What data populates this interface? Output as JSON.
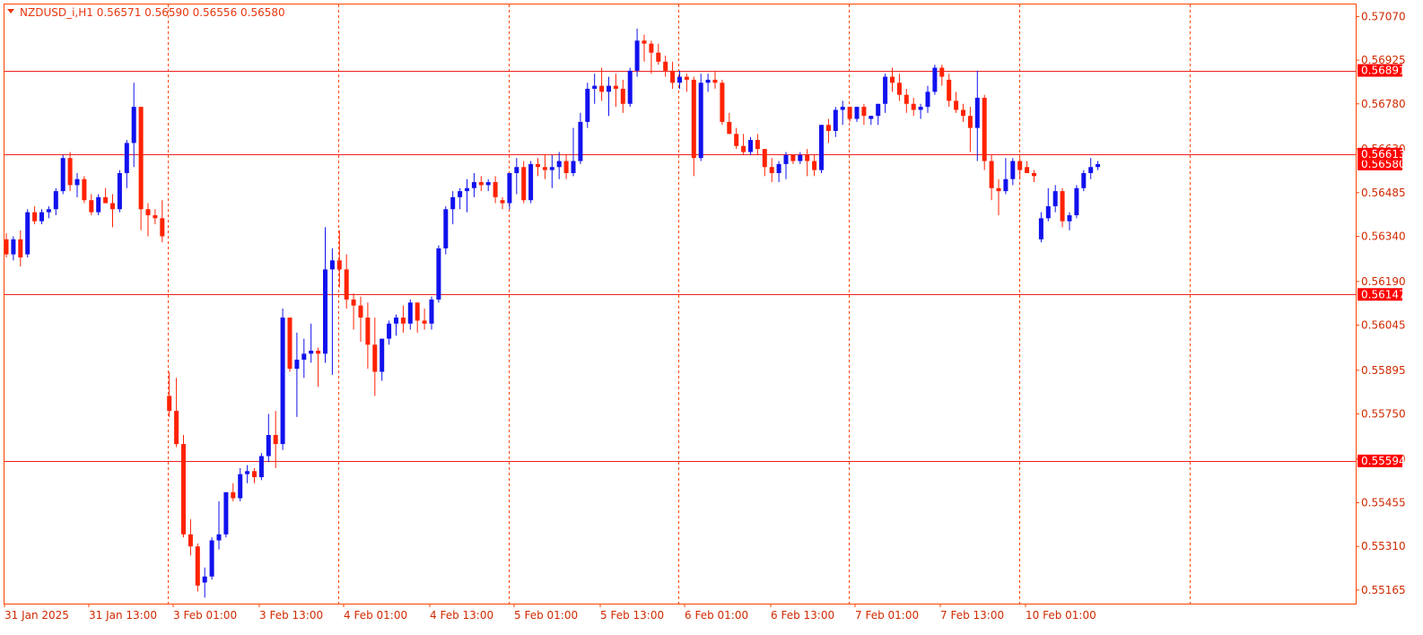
{
  "header": {
    "symbol_line": "NZDUSD_i,H1  0.56571  0.56590  0.56556  0.56580",
    "collapse_icon": "triangle-down-icon"
  },
  "colors": {
    "bull": "#1111ee",
    "bear": "#ff2200",
    "frame": "#ff4500",
    "level_line": "#ee2222",
    "separator": "#ff4500",
    "label_bg": "#ff0000",
    "label_text": "#ffffff"
  },
  "chart_data": {
    "type": "candlestick",
    "symbol": "NZDUSD_i",
    "timeframe": "H1",
    "ohlc": {
      "open": "0.56571",
      "high": "0.56590",
      "low": "0.56556",
      "close": "0.56580"
    },
    "ylim": [
      0.5512,
      0.5711
    ],
    "y_ticks": [
      "0.57070",
      "0.56925",
      "0.56780",
      "0.56630",
      "0.56485",
      "0.56340",
      "0.56190",
      "0.56045",
      "0.55895",
      "0.55750",
      "0.55600",
      "0.55455",
      "0.55310",
      "0.55165"
    ],
    "x_ticks": [
      "31 Jan 2025",
      "31 Jan 13:00",
      "3 Feb 01:00",
      "3 Feb 13:00",
      "4 Feb 01:00",
      "4 Feb 13:00",
      "5 Feb 01:00",
      "5 Feb 13:00",
      "6 Feb 01:00",
      "6 Feb 13:00",
      "7 Feb 01:00",
      "7 Feb 13:00",
      "10 Feb 01:00"
    ],
    "horizontal_levels": [
      "0.56891",
      "0.56613",
      "0.56147",
      "0.55594"
    ],
    "current_price": "0.56580",
    "grid": false,
    "candles": [
      [
        0.5633,
        0.5635,
        0.5627,
        0.5628
      ],
      [
        0.5628,
        0.5634,
        0.5626,
        0.5633
      ],
      [
        0.5633,
        0.5636,
        0.5624,
        0.5627
      ],
      [
        0.5628,
        0.5643,
        0.5627,
        0.5642
      ],
      [
        0.5642,
        0.5644,
        0.5638,
        0.5639
      ],
      [
        0.5639,
        0.5643,
        0.5638,
        0.5642
      ],
      [
        0.5642,
        0.5644,
        0.564,
        0.5643
      ],
      [
        0.5643,
        0.565,
        0.5641,
        0.5649
      ],
      [
        0.5649,
        0.5661,
        0.5648,
        0.566
      ],
      [
        0.566,
        0.5662,
        0.5649,
        0.5651
      ],
      [
        0.5651,
        0.5655,
        0.5647,
        0.5653
      ],
      [
        0.5653,
        0.5654,
        0.5645,
        0.5646
      ],
      [
        0.5646,
        0.5648,
        0.5641,
        0.5642
      ],
      [
        0.5642,
        0.5648,
        0.5641,
        0.5647
      ],
      [
        0.5647,
        0.565,
        0.5645,
        0.5645
      ],
      [
        0.5645,
        0.5648,
        0.5637,
        0.5643
      ],
      [
        0.5643,
        0.5656,
        0.5642,
        0.5655
      ],
      [
        0.5655,
        0.5666,
        0.565,
        0.5665
      ],
      [
        0.5665,
        0.5685,
        0.5657,
        0.5677
      ],
      [
        0.5677,
        0.5677,
        0.5636,
        0.5643
      ],
      [
        0.5643,
        0.5645,
        0.5634,
        0.5641
      ],
      [
        0.5641,
        0.5643,
        0.5638,
        0.564
      ],
      [
        0.564,
        0.5646,
        0.5632,
        0.5634
      ],
      [
        0.5581,
        0.5589,
        0.5574,
        0.5576
      ],
      [
        0.5576,
        0.5587,
        0.5564,
        0.5565
      ],
      [
        0.5565,
        0.5568,
        0.5534,
        0.5535
      ],
      [
        0.5535,
        0.554,
        0.5528,
        0.5531
      ],
      [
        0.5531,
        0.5532,
        0.5516,
        0.5518
      ],
      [
        0.5519,
        0.5524,
        0.5514,
        0.5521
      ],
      [
        0.5521,
        0.5534,
        0.552,
        0.5533
      ],
      [
        0.5533,
        0.5546,
        0.553,
        0.5535
      ],
      [
        0.5535,
        0.5549,
        0.5534,
        0.5549
      ],
      [
        0.5549,
        0.5552,
        0.5546,
        0.5547
      ],
      [
        0.5547,
        0.5557,
        0.5546,
        0.5555
      ],
      [
        0.5555,
        0.5558,
        0.5552,
        0.5556
      ],
      [
        0.5556,
        0.5557,
        0.5552,
        0.5554
      ],
      [
        0.5554,
        0.5562,
        0.5553,
        0.5561
      ],
      [
        0.5561,
        0.5575,
        0.5559,
        0.5568
      ],
      [
        0.5568,
        0.5576,
        0.5557,
        0.5565
      ],
      [
        0.5565,
        0.561,
        0.5563,
        0.5607
      ],
      [
        0.5607,
        0.5607,
        0.5589,
        0.559
      ],
      [
        0.559,
        0.5602,
        0.5574,
        0.5593
      ],
      [
        0.5593,
        0.56,
        0.5587,
        0.5595
      ],
      [
        0.5595,
        0.5605,
        0.5592,
        0.5596
      ],
      [
        0.5596,
        0.5597,
        0.5584,
        0.5595
      ],
      [
        0.5595,
        0.5637,
        0.5592,
        0.5623
      ],
      [
        0.5623,
        0.563,
        0.5588,
        0.5626
      ],
      [
        0.5626,
        0.5636,
        0.5617,
        0.5623
      ],
      [
        0.5623,
        0.5628,
        0.561,
        0.5613
      ],
      [
        0.5613,
        0.5615,
        0.5603,
        0.5611
      ],
      [
        0.5611,
        0.5614,
        0.5599,
        0.5607
      ],
      [
        0.5607,
        0.5612,
        0.559,
        0.5598
      ],
      [
        0.5598,
        0.5607,
        0.5581,
        0.5589
      ],
      [
        0.5589,
        0.5599,
        0.5586,
        0.56
      ],
      [
        0.56,
        0.5606,
        0.5598,
        0.5605
      ],
      [
        0.5605,
        0.5608,
        0.5601,
        0.5607
      ],
      [
        0.5607,
        0.5611,
        0.5602,
        0.5605
      ],
      [
        0.5605,
        0.5613,
        0.5603,
        0.5612
      ],
      [
        0.5612,
        0.5612,
        0.5602,
        0.5606
      ],
      [
        0.5606,
        0.561,
        0.5603,
        0.5605
      ],
      [
        0.5605,
        0.5614,
        0.5603,
        0.5613
      ],
      [
        0.5613,
        0.5631,
        0.5612,
        0.563
      ],
      [
        0.563,
        0.5644,
        0.5628,
        0.5643
      ],
      [
        0.5643,
        0.5649,
        0.5638,
        0.5647
      ],
      [
        0.5647,
        0.565,
        0.5643,
        0.5649
      ],
      [
        0.5649,
        0.5653,
        0.5642,
        0.565
      ],
      [
        0.565,
        0.5655,
        0.5647,
        0.5652
      ],
      [
        0.5652,
        0.5654,
        0.5649,
        0.5651
      ],
      [
        0.5651,
        0.5653,
        0.5649,
        0.5652
      ],
      [
        0.5652,
        0.5654,
        0.5645,
        0.5647
      ],
      [
        0.5646,
        0.5647,
        0.5643,
        0.5645
      ],
      [
        0.5645,
        0.5651,
        0.5643,
        0.5655
      ],
      [
        0.5655,
        0.566,
        0.5648,
        0.5657
      ],
      [
        0.5657,
        0.5659,
        0.5645,
        0.5646
      ],
      [
        0.5646,
        0.5659,
        0.5645,
        0.5658
      ],
      [
        0.5658,
        0.566,
        0.5654,
        0.5657
      ],
      [
        0.5657,
        0.5661,
        0.5653,
        0.5656
      ],
      [
        0.5656,
        0.5661,
        0.565,
        0.5657
      ],
      [
        0.5657,
        0.5662,
        0.5653,
        0.5659
      ],
      [
        0.5659,
        0.5661,
        0.5653,
        0.5655
      ],
      [
        0.5655,
        0.567,
        0.5654,
        0.5659
      ],
      [
        0.5659,
        0.5675,
        0.5658,
        0.5672
      ],
      [
        0.5672,
        0.5685,
        0.567,
        0.5683
      ],
      [
        0.5683,
        0.5688,
        0.5678,
        0.5684
      ],
      [
        0.5684,
        0.569,
        0.5679,
        0.5682
      ],
      [
        0.5682,
        0.5687,
        0.5674,
        0.5684
      ],
      [
        0.5684,
        0.5688,
        0.5677,
        0.5683
      ],
      [
        0.5683,
        0.5686,
        0.5675,
        0.5678
      ],
      [
        0.5678,
        0.569,
        0.5677,
        0.5689
      ],
      [
        0.5689,
        0.5703,
        0.5687,
        0.5699
      ],
      [
        0.5699,
        0.5701,
        0.5692,
        0.5698
      ],
      [
        0.5698,
        0.5699,
        0.5688,
        0.5695
      ],
      [
        0.5695,
        0.5698,
        0.5691,
        0.5692
      ],
      [
        0.5692,
        0.5694,
        0.5687,
        0.5689
      ],
      [
        0.5689,
        0.5692,
        0.5683,
        0.5685
      ],
      [
        0.5685,
        0.5689,
        0.5683,
        0.5687
      ],
      [
        0.5687,
        0.5688,
        0.5682,
        0.5686
      ],
      [
        0.5686,
        0.5687,
        0.5654,
        0.566
      ],
      [
        0.566,
        0.5688,
        0.5659,
        0.5685
      ],
      [
        0.5685,
        0.5688,
        0.5682,
        0.5686
      ],
      [
        0.5686,
        0.5689,
        0.5683,
        0.5685
      ],
      [
        0.5685,
        0.5686,
        0.5671,
        0.5672
      ],
      [
        0.5672,
        0.5675,
        0.5668,
        0.5668
      ],
      [
        0.5668,
        0.567,
        0.5663,
        0.5664
      ],
      [
        0.5664,
        0.5668,
        0.5661,
        0.5662
      ],
      [
        0.5662,
        0.5667,
        0.5661,
        0.5666
      ],
      [
        0.5666,
        0.5668,
        0.5661,
        0.5663
      ],
      [
        0.5663,
        0.5663,
        0.5654,
        0.5657
      ],
      [
        0.5657,
        0.566,
        0.5652,
        0.5655
      ],
      [
        0.5655,
        0.5659,
        0.5652,
        0.5658
      ],
      [
        0.5658,
        0.5662,
        0.5653,
        0.5661
      ],
      [
        0.5661,
        0.5661,
        0.5658,
        0.5659
      ],
      [
        0.5659,
        0.5662,
        0.5658,
        0.5661
      ],
      [
        0.5661,
        0.5663,
        0.5654,
        0.5659
      ],
      [
        0.5659,
        0.5661,
        0.5654,
        0.5656
      ],
      [
        0.5656,
        0.5671,
        0.5655,
        0.5671
      ],
      [
        0.5671,
        0.5673,
        0.5665,
        0.5669
      ],
      [
        0.5669,
        0.5677,
        0.5667,
        0.5676
      ],
      [
        0.5676,
        0.5679,
        0.5671,
        0.5677
      ],
      [
        0.5677,
        0.5677,
        0.5672,
        0.5673
      ],
      [
        0.5673,
        0.5677,
        0.5672,
        0.5677
      ],
      [
        0.5677,
        0.5678,
        0.5671,
        0.5674
      ],
      [
        0.5673,
        0.5674,
        0.5671,
        0.5674
      ],
      [
        0.5674,
        0.5678,
        0.5671,
        0.5678
      ],
      [
        0.5678,
        0.5688,
        0.5675,
        0.5687
      ],
      [
        0.5687,
        0.569,
        0.5682,
        0.5685
      ],
      [
        0.5685,
        0.5688,
        0.5679,
        0.5681
      ],
      [
        0.5681,
        0.5683,
        0.5675,
        0.5678
      ],
      [
        0.5678,
        0.568,
        0.5674,
        0.5676
      ],
      [
        0.5676,
        0.5678,
        0.5673,
        0.5677
      ],
      [
        0.5677,
        0.5684,
        0.5675,
        0.5682
      ],
      [
        0.5682,
        0.5691,
        0.5681,
        0.569
      ],
      [
        0.569,
        0.5691,
        0.5684,
        0.5687
      ],
      [
        0.5686,
        0.5688,
        0.5677,
        0.5679
      ],
      [
        0.5679,
        0.5682,
        0.5675,
        0.5676
      ],
      [
        0.5676,
        0.5678,
        0.5672,
        0.5674
      ],
      [
        0.5674,
        0.5677,
        0.5662,
        0.567
      ],
      [
        0.567,
        0.5689,
        0.5659,
        0.568
      ],
      [
        0.568,
        0.5681,
        0.5656,
        0.5659
      ],
      [
        0.5659,
        0.5661,
        0.5646,
        0.565
      ],
      [
        0.565,
        0.5653,
        0.5641,
        0.5649
      ],
      [
        0.5649,
        0.566,
        0.5648,
        0.5653
      ],
      [
        0.5653,
        0.566,
        0.5651,
        0.5659
      ],
      [
        0.5659,
        0.566,
        0.5653,
        0.5656
      ],
      [
        0.5657,
        0.5659,
        0.5655,
        0.5655
      ],
      [
        0.5655,
        0.5656,
        0.5652,
        0.5654
      ],
      [
        0.5633,
        0.5642,
        0.5632,
        0.564
      ],
      [
        0.564,
        0.565,
        0.5639,
        0.5644
      ],
      [
        0.5644,
        0.5651,
        0.5642,
        0.5649
      ],
      [
        0.5649,
        0.565,
        0.5637,
        0.5639
      ],
      [
        0.5639,
        0.5642,
        0.5636,
        0.5641
      ],
      [
        0.5641,
        0.5651,
        0.564,
        0.565
      ],
      [
        0.565,
        0.5656,
        0.5649,
        0.5655
      ],
      [
        0.5655,
        0.566,
        0.5653,
        0.5657
      ],
      [
        0.5657,
        0.5659,
        0.5656,
        0.5658
      ]
    ]
  }
}
